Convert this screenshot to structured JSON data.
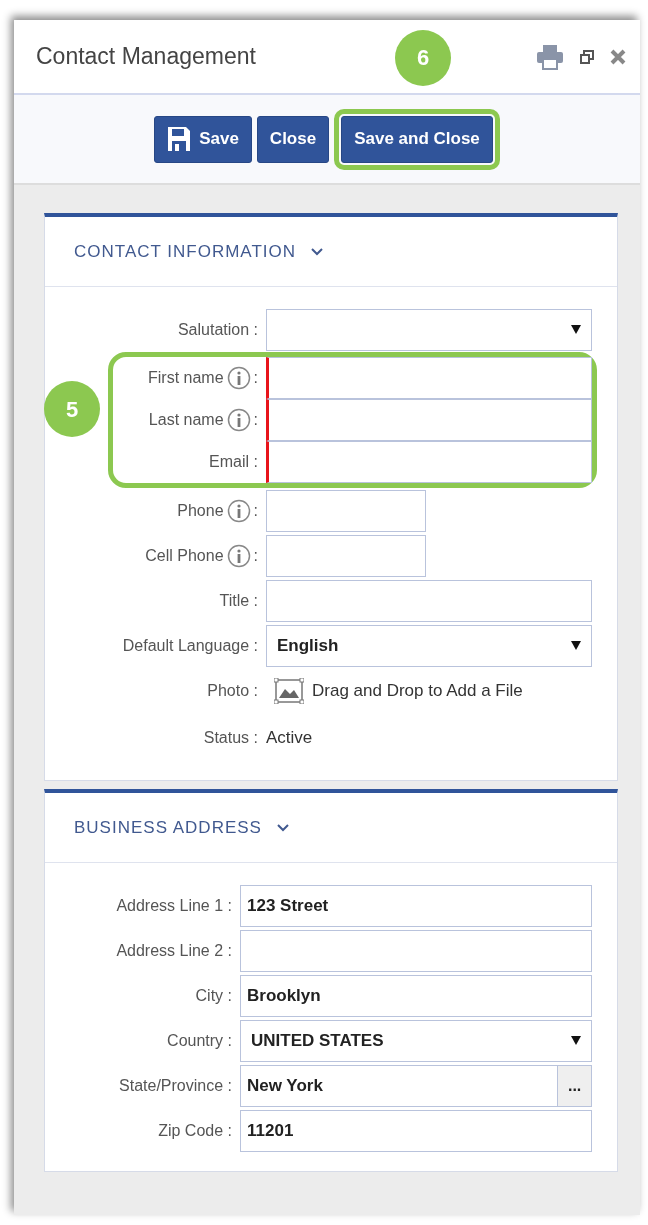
{
  "window": {
    "title": "Contact Management"
  },
  "toolbar": {
    "buttons": [
      {
        "label": "Save",
        "highlighted": false
      },
      {
        "label": "Close",
        "highlighted": false
      },
      {
        "label": "Save and Close",
        "highlighted": true,
        "callout": "6"
      }
    ]
  },
  "sections": [
    {
      "title": "CONTACT INFORMATION",
      "expanded": true,
      "callout": "5",
      "fields": [
        {
          "kind": "select",
          "label": "Salutation :",
          "required": false,
          "highlighted": false
        },
        {
          "kind": "text",
          "label": "First name",
          "info": true,
          "after_info": ":",
          "required": true,
          "highlighted": true
        },
        {
          "kind": "text",
          "label": "Last name",
          "info": true,
          "after_info": ":",
          "required": true,
          "highlighted": true
        },
        {
          "kind": "text",
          "label": "Email :",
          "required": true,
          "highlighted": true
        },
        {
          "kind": "text",
          "label": "Phone",
          "info": true,
          "after_info": ":",
          "narrow": true,
          "required": false,
          "highlighted": false
        },
        {
          "kind": "text",
          "label": "Cell Phone",
          "info": true,
          "after_info": ":",
          "narrow": true,
          "required": false,
          "highlighted": false
        },
        {
          "kind": "text",
          "label": "Title :",
          "required": false,
          "highlighted": false
        },
        {
          "kind": "select",
          "label": "Default Language :",
          "value": "English",
          "required": false,
          "highlighted": false
        },
        {
          "kind": "photo",
          "label": "Photo :",
          "value": "Drag and Drop to Add a File",
          "highlighted": false
        },
        {
          "kind": "static",
          "label": "Status :",
          "value": "Active",
          "highlighted": false
        }
      ]
    },
    {
      "title": "BUSINESS ADDRESS",
      "expanded": true,
      "fields": [
        {
          "kind": "text",
          "label": "Address Line 1 :",
          "value": "123 Street",
          "required": false,
          "highlighted": false
        },
        {
          "kind": "text",
          "label": "Address Line 2 :",
          "required": false,
          "highlighted": false
        },
        {
          "kind": "text",
          "label": "City :",
          "value": "Brooklyn",
          "required": false,
          "highlighted": false
        },
        {
          "kind": "select",
          "label": "Country :",
          "value": "UNITED STATES",
          "required": false,
          "highlighted": false
        },
        {
          "kind": "lookup",
          "label": "State/Province :",
          "value": "New York",
          "button_label": "...",
          "required": false,
          "highlighted": false
        },
        {
          "kind": "text",
          "label": "Zip Code :",
          "value": "11201",
          "required": false,
          "highlighted": false
        }
      ]
    }
  ]
}
